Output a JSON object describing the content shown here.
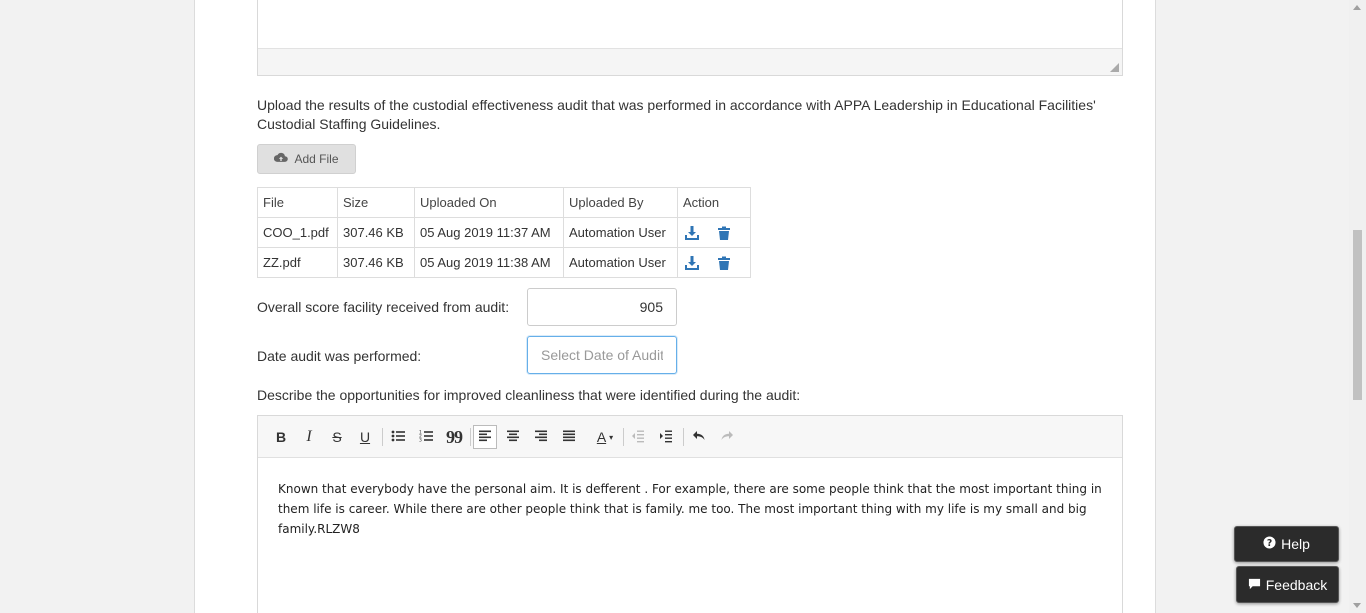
{
  "upload": {
    "description": "Upload the results of the custodial effectiveness audit that was performed in accordance with APPA Leadership in Educational Facilities' Custodial Staffing Guidelines.",
    "add_file_label": "Add File"
  },
  "files_table": {
    "headers": [
      "File",
      "Size",
      "Uploaded On",
      "Uploaded By",
      "Action"
    ],
    "rows": [
      {
        "file": "COO_1.pdf",
        "size": "307.46 KB",
        "uploaded_on": "05 Aug 2019 11:37 AM",
        "uploaded_by": "Automation User"
      },
      {
        "file": "ZZ.pdf",
        "size": "307.46 KB",
        "uploaded_on": "05 Aug 2019 11:38 AM",
        "uploaded_by": "Automation User"
      }
    ],
    "action_icons": [
      "download-icon",
      "trash-icon"
    ]
  },
  "score": {
    "label": "Overall score facility received from audit:",
    "value": "905"
  },
  "date": {
    "label": "Date audit was performed:",
    "placeholder": "Select Date of Audit"
  },
  "opportunities": {
    "label": "Describe the opportunities for improved cleanliness that were identified during the audit:",
    "text": "Known that everybody have the personal aim. It is defferent . For example, there are some people think that the most important thing in them life is career. While there are other people think that is family. me too. The most important thing with my life is my small and big family.RLZW8"
  },
  "toolbar": {
    "bold": "B",
    "italic": "I",
    "strike": "S",
    "underline": "U",
    "quote": "99",
    "font_color": "A"
  },
  "floating": {
    "help_label": "Help",
    "feedback_label": "Feedback"
  },
  "colors": {
    "accent_blue": "#2f75b5",
    "float_bg": "#2b2b2b"
  }
}
